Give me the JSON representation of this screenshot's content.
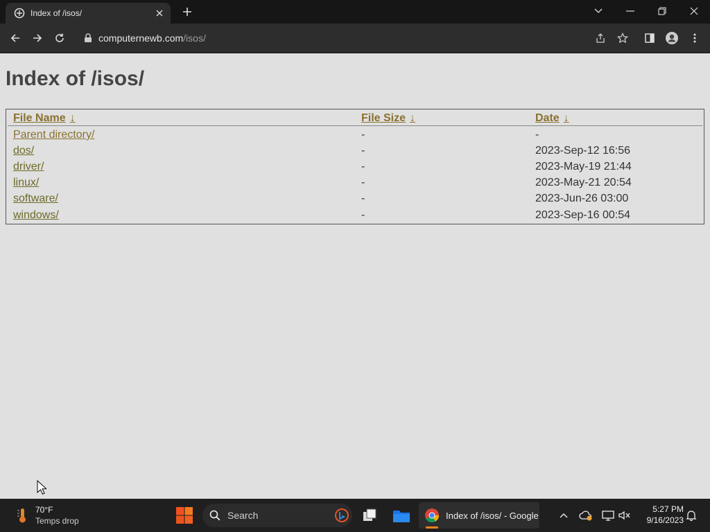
{
  "browser": {
    "tab_title": "Index of /isos/",
    "url_host": "computernewb.com",
    "url_path": "/isos/"
  },
  "page": {
    "title": "Index of /isos/",
    "columns": {
      "name": "File Name",
      "size": "File Size",
      "date": "Date",
      "sort_arrow": "↓"
    },
    "rows": [
      {
        "name": "Parent directory/",
        "size": "-",
        "date": "-"
      },
      {
        "name": "dos/",
        "size": "-",
        "date": "2023-Sep-12 16:56"
      },
      {
        "name": "driver/",
        "size": "-",
        "date": "2023-May-19 21:44"
      },
      {
        "name": "linux/",
        "size": "-",
        "date": "2023-May-21 20:54"
      },
      {
        "name": "software/",
        "size": "-",
        "date": "2023-Jun-26 03:00"
      },
      {
        "name": "windows/",
        "size": "-",
        "date": "2023-Sep-16 00:54"
      }
    ]
  },
  "taskbar": {
    "weather_temp": "70°F",
    "weather_text": "Temps drop",
    "search_label": "Search",
    "chrome_label": "Index of /isos/ - Google",
    "time": "5:27 PM",
    "date": "9/16/2023"
  },
  "colors": {
    "link": "#6d6a28",
    "header_link": "#8a7130",
    "page_bg": "#e0e0e0"
  },
  "icons": [
    "site-favicon-icon",
    "close-icon",
    "plus-icon",
    "chevron-down-icon",
    "minimize-icon",
    "restore-icon",
    "window-close-icon",
    "back-arrow-icon",
    "forward-arrow-icon",
    "reload-icon",
    "lock-icon",
    "share-icon",
    "star-icon",
    "side-panel-icon",
    "profile-icon",
    "kebab-menu-icon",
    "thermometer-icon",
    "windows-logo-icon",
    "search-icon",
    "bing-icon",
    "task-view-icon",
    "file-explorer-icon",
    "chrome-icon",
    "chevron-up-icon",
    "onedrive-icon",
    "network-icon",
    "volume-muted-icon",
    "notification-bell-icon"
  ]
}
